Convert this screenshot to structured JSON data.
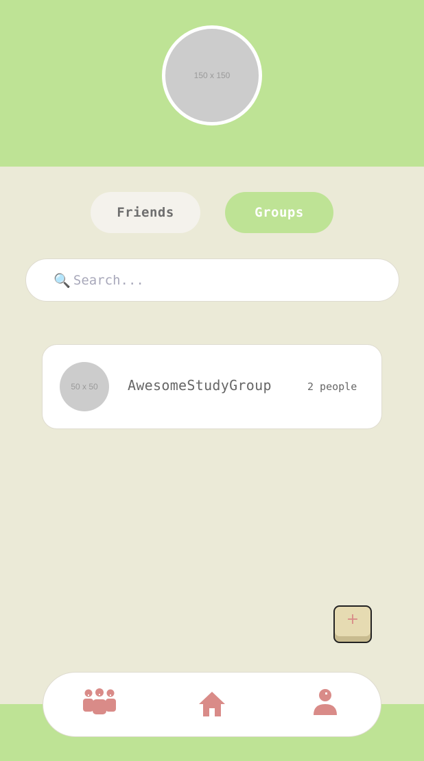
{
  "header": {
    "avatar_placeholder": "150 x 150"
  },
  "tabs": [
    {
      "label": "Friends",
      "active": false
    },
    {
      "label": "Groups",
      "active": true
    }
  ],
  "search": {
    "placeholder": "Search...",
    "value": "",
    "icon": "magnifier-icon"
  },
  "groups": [
    {
      "avatar_placeholder": "50 x 50",
      "name": "AwesomeStudyGroup",
      "members": "2 people"
    }
  ],
  "fab": {
    "label": "+"
  },
  "nav": {
    "items": [
      {
        "icon": "group-icon"
      },
      {
        "icon": "home-icon"
      },
      {
        "icon": "profile-icon"
      }
    ]
  },
  "colors": {
    "accent_green": "#bee395",
    "background": "#ebead7",
    "icon_pink": "#d98b88",
    "fab_tan": "#e6dbb2"
  }
}
